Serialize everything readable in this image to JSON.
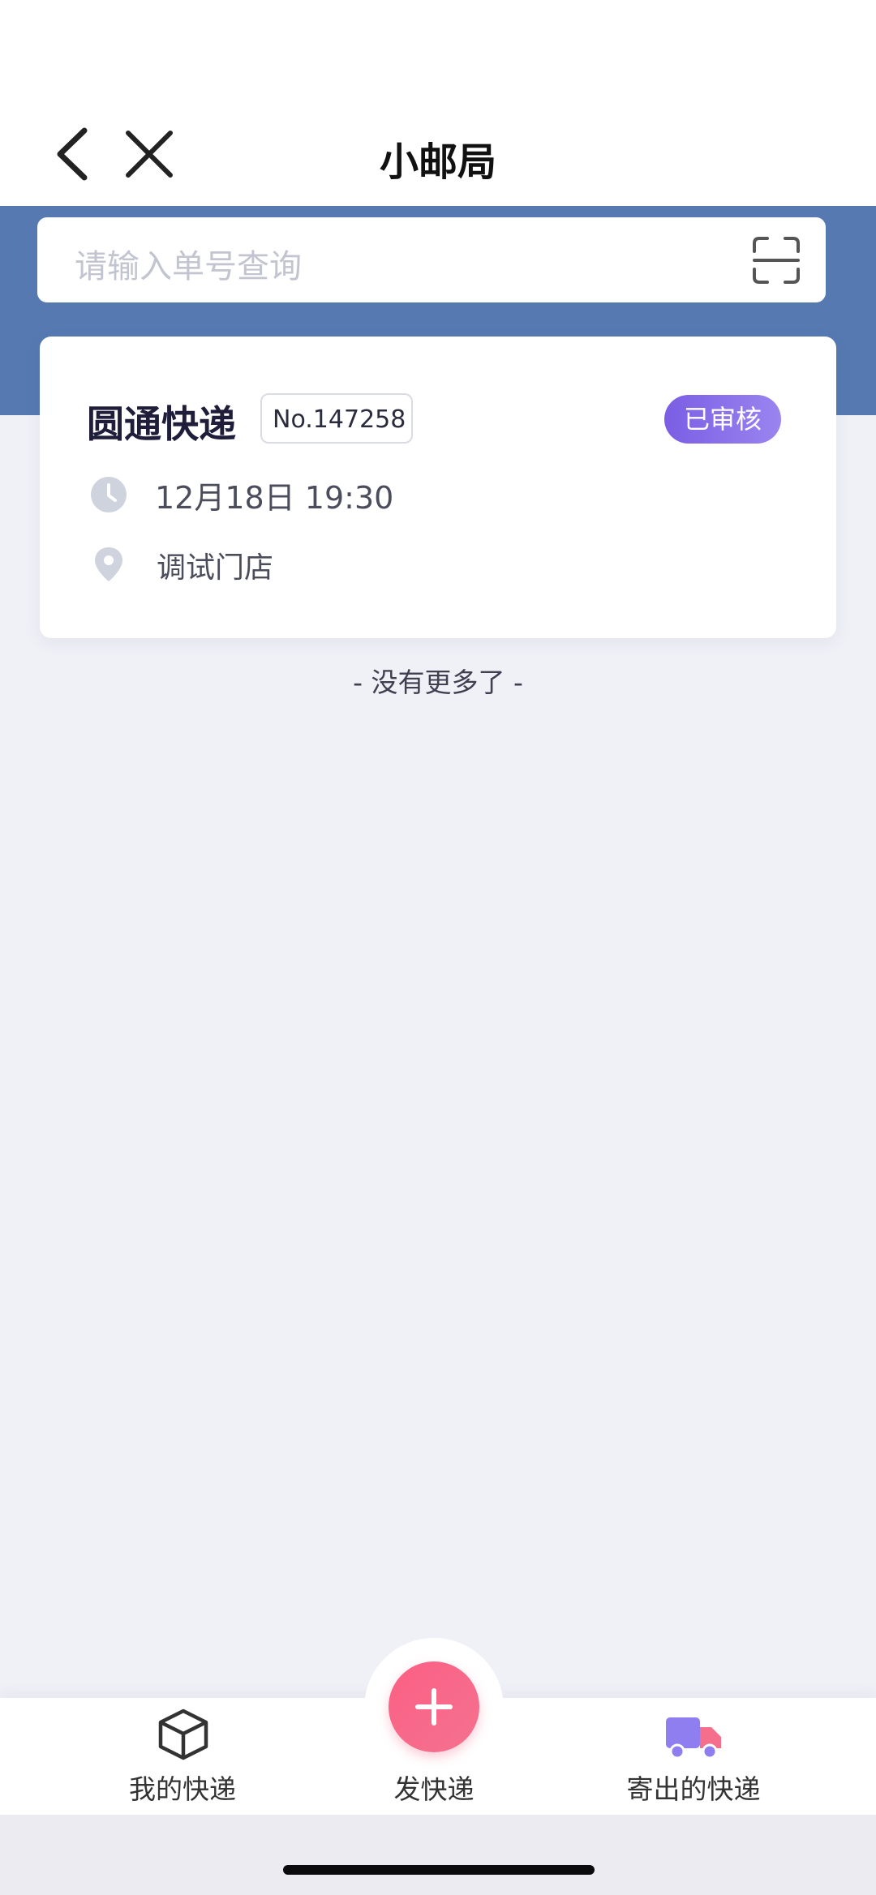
{
  "nav": {
    "title": "小邮局",
    "back_icon": "chevron-left-icon",
    "close_icon": "close-icon"
  },
  "search": {
    "placeholder": "请输入单号查询",
    "scan_icon": "scan-icon"
  },
  "parcel": {
    "company": "圆通快递",
    "order_no": "No.147258",
    "status": "已审核",
    "time": "12月18日 19:30",
    "store": "调试门店"
  },
  "list_end_text": "- 没有更多了 -",
  "tabbar": {
    "tabs": [
      {
        "label": "我的快递",
        "icon": "package-box-icon"
      },
      {
        "label": "发快递",
        "icon": "plus-icon"
      },
      {
        "label": "寄出的快递",
        "icon": "delivery-truck-icon"
      }
    ]
  },
  "colors": {
    "header_band": "#5679b1",
    "status_badge": "#7b5ee4",
    "fab": "#fb5f84",
    "background": "#f0f1f7"
  }
}
